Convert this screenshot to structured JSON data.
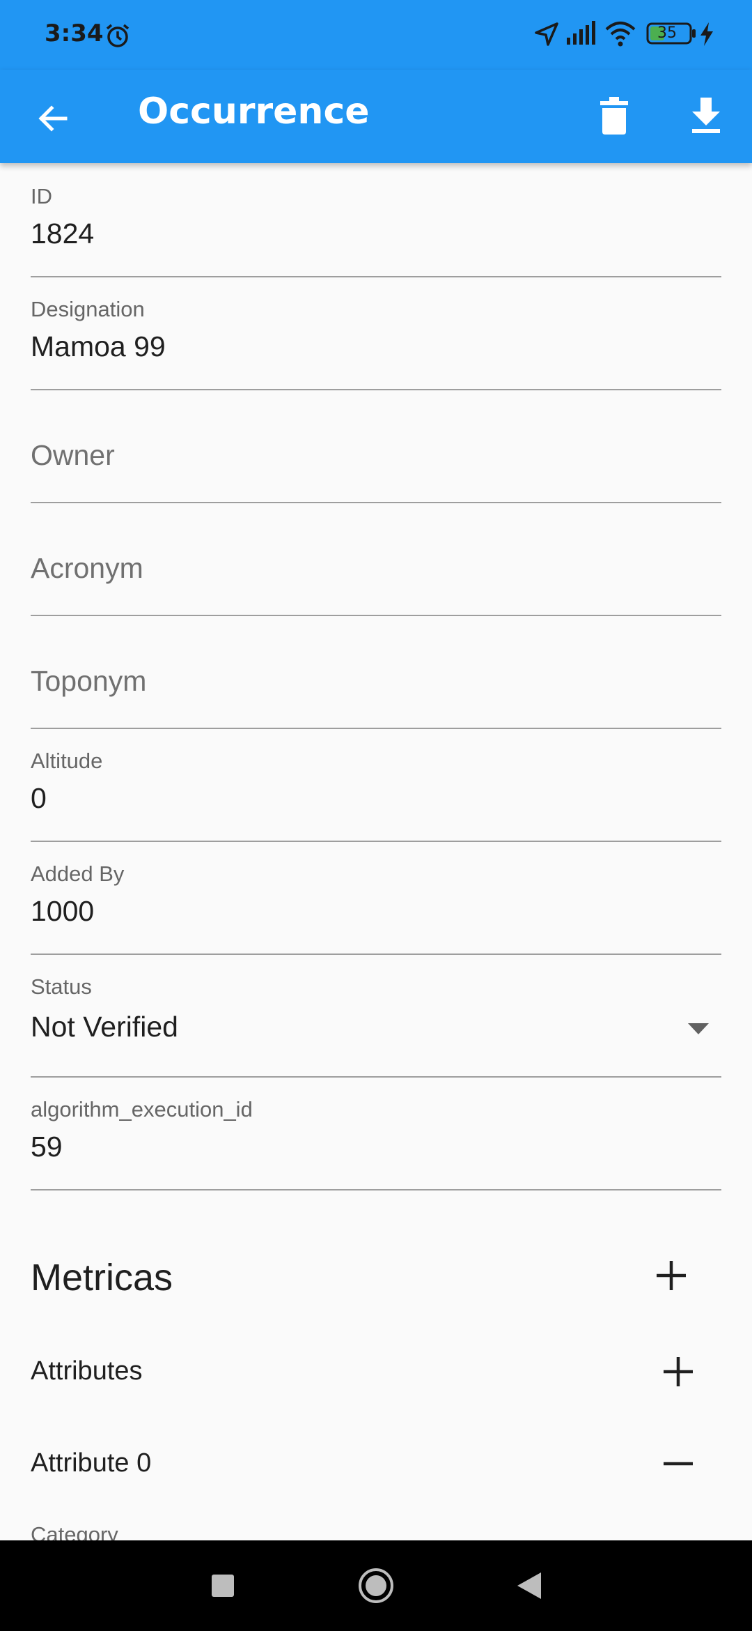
{
  "status_bar": {
    "time": "3:34",
    "battery": "35",
    "icons": [
      "alarm-icon",
      "location-arrow-icon",
      "signal-icon",
      "wifi-icon",
      "battery-icon",
      "charging-bolt-icon"
    ]
  },
  "app_bar": {
    "title": "Occurrence",
    "back_icon": "arrow-left-icon",
    "delete_icon": "trash-icon",
    "download_icon": "download-icon",
    "color": "#2196f3"
  },
  "form": {
    "id": {
      "label": "ID",
      "value": "1824"
    },
    "designation": {
      "label": "Designation",
      "value": "Mamoa 99"
    },
    "owner": {
      "hint": "Owner"
    },
    "acronym": {
      "hint": "Acronym"
    },
    "toponym": {
      "hint": "Toponym"
    },
    "altitude": {
      "label": "Altitude",
      "value": "0"
    },
    "added_by": {
      "label": "Added By",
      "value": "1000"
    },
    "status": {
      "label": "Status",
      "value": "Not Verified"
    },
    "algorithm": {
      "label": "algorithm_execution_id",
      "value": "59"
    }
  },
  "metricas": {
    "title": "Metricas"
  },
  "attributes": {
    "title": "Attributes"
  },
  "attribute0": {
    "title": "Attribute 0"
  },
  "category": {
    "label": "Category"
  }
}
